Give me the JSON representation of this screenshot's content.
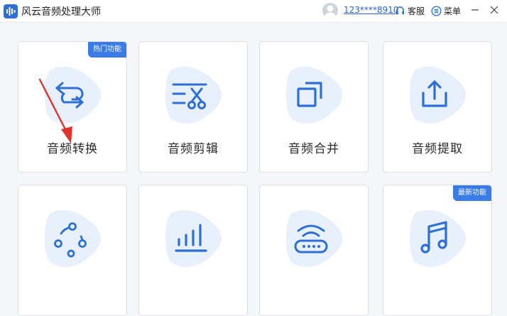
{
  "app": {
    "title": "风云音频处理大师",
    "user": "123****8910",
    "service_label": "客服",
    "menu_label": "菜单"
  },
  "colors": {
    "accent": "#3a7be6",
    "icon": "#2e6fd6",
    "blob": "#e8f0fc",
    "badge_bg": "#3a7be6"
  },
  "cards": [
    {
      "label": "音频转换",
      "icon": "convert-icon",
      "badge": "热门功能"
    },
    {
      "label": "音频剪辑",
      "icon": "scissors-icon"
    },
    {
      "label": "音频合并",
      "icon": "merge-icon"
    },
    {
      "label": "音频提取",
      "icon": "upload-icon"
    },
    {
      "label": "",
      "icon": "share-icon"
    },
    {
      "label": "",
      "icon": "bar-chart-icon"
    },
    {
      "label": "",
      "icon": "router-icon"
    },
    {
      "label": "",
      "icon": "music-note-icon",
      "badge": "最新功能"
    }
  ]
}
